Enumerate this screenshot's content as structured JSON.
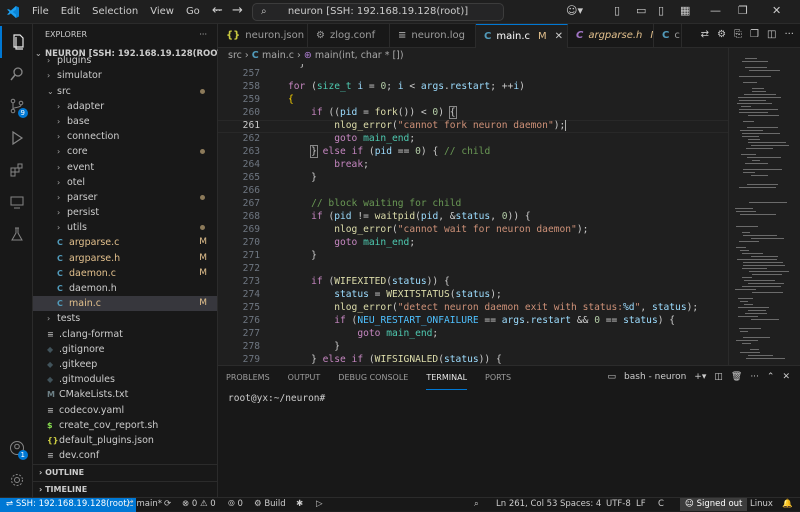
{
  "titlebar": {
    "menus": [
      "File",
      "Edit",
      "Selection",
      "View",
      "Go"
    ],
    "more": "···",
    "command_center": "neuron [SSH: 192.168.19.128(root)]"
  },
  "activity": {
    "scm_badge": "9",
    "remote_badge": "1"
  },
  "explorer": {
    "title": "EXPLORER",
    "root": "NEURON [SSH: 192.168.19.128(ROOT)]",
    "items": [
      {
        "label": "plugins",
        "depth": 1,
        "kind": "folder",
        "expanded": false
      },
      {
        "label": "simulator",
        "depth": 1,
        "kind": "folder",
        "expanded": false
      },
      {
        "label": "src",
        "depth": 1,
        "kind": "folder",
        "expanded": true,
        "dot": true
      },
      {
        "label": "adapter",
        "depth": 2,
        "kind": "folder",
        "expanded": false
      },
      {
        "label": "base",
        "depth": 2,
        "kind": "folder",
        "expanded": false
      },
      {
        "label": "connection",
        "depth": 2,
        "kind": "folder",
        "expanded": false
      },
      {
        "label": "core",
        "depth": 2,
        "kind": "folder",
        "expanded": false,
        "dot": true
      },
      {
        "label": "event",
        "depth": 2,
        "kind": "folder",
        "expanded": false
      },
      {
        "label": "otel",
        "depth": 2,
        "kind": "folder",
        "expanded": false
      },
      {
        "label": "parser",
        "depth": 2,
        "kind": "folder",
        "expanded": false,
        "dot": true
      },
      {
        "label": "persist",
        "depth": 2,
        "kind": "folder",
        "expanded": false
      },
      {
        "label": "utils",
        "depth": 2,
        "kind": "folder",
        "expanded": false,
        "dot": true
      },
      {
        "label": "argparse.c",
        "depth": 2,
        "kind": "c",
        "status": "M"
      },
      {
        "label": "argparse.h",
        "depth": 2,
        "kind": "c",
        "status": "M"
      },
      {
        "label": "daemon.c",
        "depth": 2,
        "kind": "c",
        "status": "M"
      },
      {
        "label": "daemon.h",
        "depth": 2,
        "kind": "c"
      },
      {
        "label": "main.c",
        "depth": 2,
        "kind": "c",
        "status": "M",
        "selected": true
      },
      {
        "label": "tests",
        "depth": 1,
        "kind": "folder",
        "expanded": false
      },
      {
        "label": ".clang-format",
        "depth": 1,
        "kind": "cfg"
      },
      {
        "label": ".gitignore",
        "depth": 1,
        "kind": "git"
      },
      {
        "label": ".gitkeep",
        "depth": 1,
        "kind": "git"
      },
      {
        "label": ".gitmodules",
        "depth": 1,
        "kind": "git"
      },
      {
        "label": "CMakeLists.txt",
        "depth": 1,
        "kind": "cmake"
      },
      {
        "label": "codecov.yaml",
        "depth": 1,
        "kind": "cfg"
      },
      {
        "label": "create_cov_report.sh",
        "depth": 1,
        "kind": "sh"
      },
      {
        "label": "default_plugins.json",
        "depth": 1,
        "kind": "json"
      },
      {
        "label": "dev.conf",
        "depth": 1,
        "kind": "cfg"
      }
    ],
    "outline": "OUTLINE",
    "timeline": "TIMELINE"
  },
  "tabs": [
    {
      "label": "neuron.json",
      "icon": "{}",
      "color": "#cbcb41"
    },
    {
      "label": "zlog.conf",
      "icon": "⚙",
      "color": "#9d9d9d"
    },
    {
      "label": "neuron.log",
      "icon": "≡",
      "color": "#9d9d9d"
    },
    {
      "label": "main.c",
      "icon": "C",
      "color": "#519aba",
      "mod": "M",
      "active": true
    },
    {
      "label": "argparse.h",
      "icon": "C",
      "color": "#a074c4",
      "mod": "M"
    },
    {
      "label": "c",
      "icon": "C",
      "color": "#519aba"
    }
  ],
  "breadcrumb": {
    "folder": "src",
    "file": "main.c",
    "symbol": "main(int, char * [])"
  },
  "editor": {
    "lines": [
      "257",
      "258",
      "259",
      "260",
      "261",
      "262",
      "263",
      "264",
      "265",
      "266",
      "267",
      "268",
      "269",
      "270",
      "271",
      "272",
      "273",
      "274",
      "275",
      "276",
      "277",
      "278",
      "279"
    ],
    "current_line": "261"
  },
  "panel": {
    "tabs": [
      "PROBLEMS",
      "OUTPUT",
      "DEBUG CONSOLE",
      "TERMINAL",
      "PORTS"
    ],
    "active": "TERMINAL",
    "terminal_name": "bash - neuron",
    "prompt": "root@yx:~/neuron#"
  },
  "status": {
    "remote": "SSH: 192.168.19.128(root)",
    "branch": "main*",
    "errors": "0",
    "warnings": "0",
    "ports": "0",
    "build": "Build",
    "position": "Ln 261, Col 53",
    "spaces": "Spaces: 4",
    "encoding": "UTF-8",
    "eol": "LF",
    "lang": "C",
    "account": "Signed out",
    "platform": "Linux"
  }
}
